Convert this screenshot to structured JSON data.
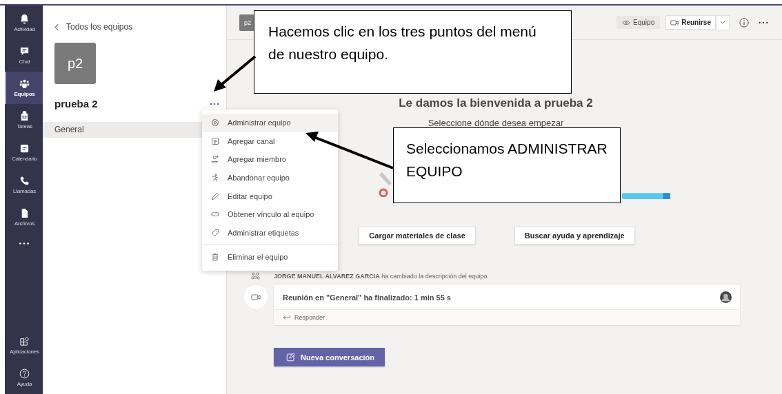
{
  "rail": {
    "items": [
      {
        "label": "Actividad",
        "selected": false
      },
      {
        "label": "Chat",
        "selected": false
      },
      {
        "label": "Equipos",
        "selected": true
      },
      {
        "label": "Tareas",
        "selected": false
      },
      {
        "label": "Calendario",
        "selected": false
      },
      {
        "label": "Llamadas",
        "selected": false
      },
      {
        "label": "Archivos",
        "selected": false
      }
    ],
    "bottom_items": [
      {
        "label": "Aplicaciones"
      },
      {
        "label": "Ayuda"
      }
    ]
  },
  "channel_panel": {
    "back_link": "Todos los equipos",
    "team_avatar": "p2",
    "team_name": "prueba 2",
    "channels": [
      {
        "name": "General",
        "selected": true
      }
    ]
  },
  "team_menu": {
    "sections": [
      [
        {
          "kind": "manage",
          "label": "Administrar equipo",
          "selected": true
        },
        {
          "kind": "channel",
          "label": "Agregar canal",
          "selected": false
        },
        {
          "kind": "member",
          "label": "Agregar miembro",
          "selected": false
        },
        {
          "kind": "leave",
          "label": "Abandonar equipo",
          "selected": false
        },
        {
          "kind": "edit",
          "label": "Editar equipo",
          "selected": false
        },
        {
          "kind": "link",
          "label": "Obtener vínculo al equipo",
          "selected": false
        },
        {
          "kind": "tag",
          "label": "Administrar etiquetas",
          "selected": false
        }
      ],
      [
        {
          "kind": "delete",
          "label": "Eliminar el equipo",
          "selected": false
        }
      ]
    ]
  },
  "header": {
    "team_badge": "p2",
    "view_chip": "Equipo",
    "meet_button": "Reunirse"
  },
  "welcome": {
    "title": "Le damos la bienvenida a prueba 2",
    "subtitle": "Seleccione dónde desea empezar",
    "actions": [
      "Cargar materiales de clase",
      "Buscar ayuda y aprendizaje"
    ]
  },
  "activity": {
    "text": "**JORGE MANUEL ALVAREZ GARCIA** ha cambiado la descripción del equipo."
  },
  "meeting_card": {
    "title": "Reunión en \"General\" ha finalizado: 1 min 55 s",
    "reply": "Responder"
  },
  "compose_button": "Nueva conversación",
  "callouts": [
    {
      "text": "Hacemos clic en los tres puntos del menú de nuestro equipo."
    },
    {
      "text": "Seleccionamos ADMINISTRAR EQUIPO"
    }
  ]
}
